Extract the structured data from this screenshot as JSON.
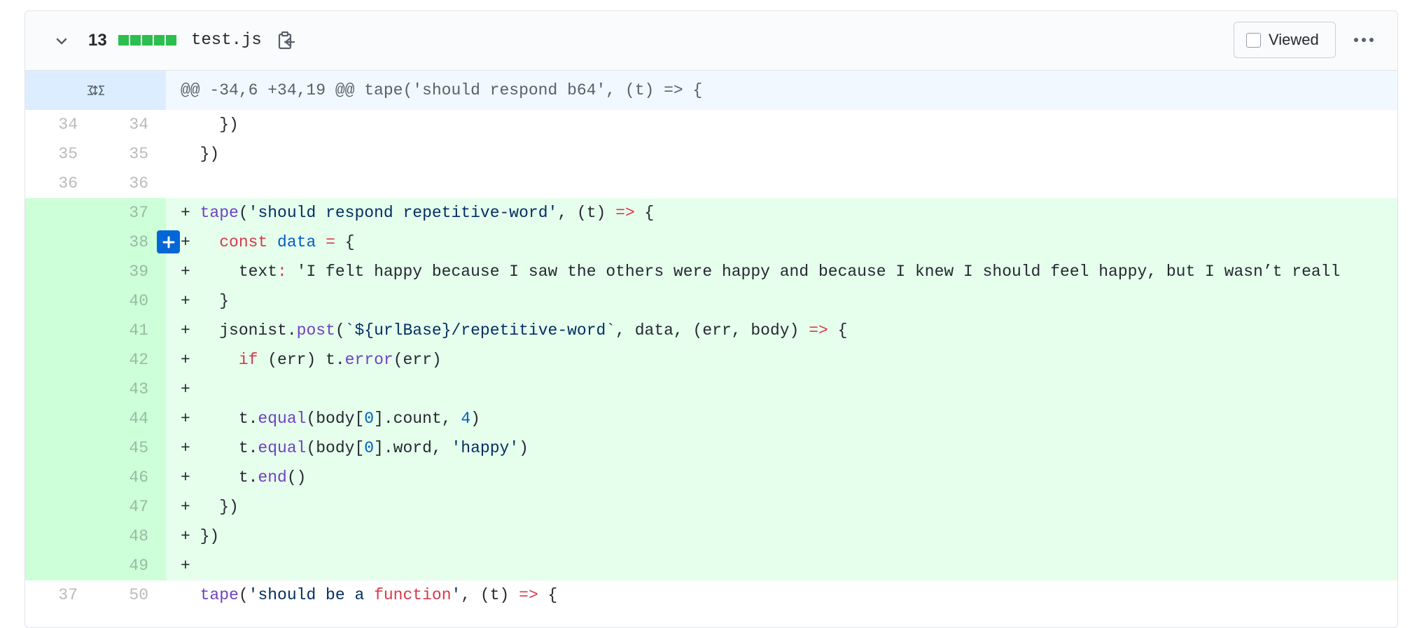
{
  "file": {
    "changes": "13",
    "name": "test.js",
    "viewed_label": "Viewed",
    "icons": {
      "collapse": "chevron-down-icon",
      "copy": "clipboard-copy-icon",
      "more": "kebab-horizontal-icon",
      "expand": "unfold-icon",
      "add_comment": "plus-icon"
    },
    "colors": {
      "added_bg": "#e6ffed",
      "added_num_bg": "#cdffd8",
      "hunk_bg": "#f1f8ff",
      "diffstat": "#2cbe4e"
    }
  },
  "hunk": {
    "header": "@@ -34,6 +34,19 @@ tape('should respond b64', (t) => {"
  },
  "lines": [
    {
      "old": "34",
      "new": "34",
      "type": "ctx",
      "text": "    })"
    },
    {
      "old": "35",
      "new": "35",
      "type": "ctx",
      "text": "  })"
    },
    {
      "old": "36",
      "new": "36",
      "type": "ctx",
      "text": ""
    },
    {
      "old": "",
      "new": "37",
      "type": "add",
      "text": "+ tape('should respond repetitive-word', (t) => {"
    },
    {
      "old": "",
      "new": "38",
      "type": "add",
      "text": "+   const data = {"
    },
    {
      "old": "",
      "new": "39",
      "type": "add",
      "text": "+     text: 'I felt happy because I saw the others were happy and because I knew I should feel happy, but I wasn’t reall"
    },
    {
      "old": "",
      "new": "40",
      "type": "add",
      "text": "+   }"
    },
    {
      "old": "",
      "new": "41",
      "type": "add",
      "text": "+   jsonist.post(`${urlBase}/repetitive-word`, data, (err, body) => {"
    },
    {
      "old": "",
      "new": "42",
      "type": "add",
      "text": "+     if (err) t.error(err)"
    },
    {
      "old": "",
      "new": "43",
      "type": "add",
      "text": "+"
    },
    {
      "old": "",
      "new": "44",
      "type": "add",
      "text": "+     t.equal(body[0].count, 4)"
    },
    {
      "old": "",
      "new": "45",
      "type": "add",
      "text": "+     t.equal(body[0].word, 'happy')"
    },
    {
      "old": "",
      "new": "46",
      "type": "add",
      "text": "+     t.end()"
    },
    {
      "old": "",
      "new": "47",
      "type": "add",
      "text": "+   })"
    },
    {
      "old": "",
      "new": "48",
      "type": "add",
      "text": "+ })"
    },
    {
      "old": "",
      "new": "49",
      "type": "add",
      "text": "+"
    },
    {
      "old": "37",
      "new": "50",
      "type": "ctx",
      "text": "  tape('should be a function', (t) => {"
    }
  ]
}
